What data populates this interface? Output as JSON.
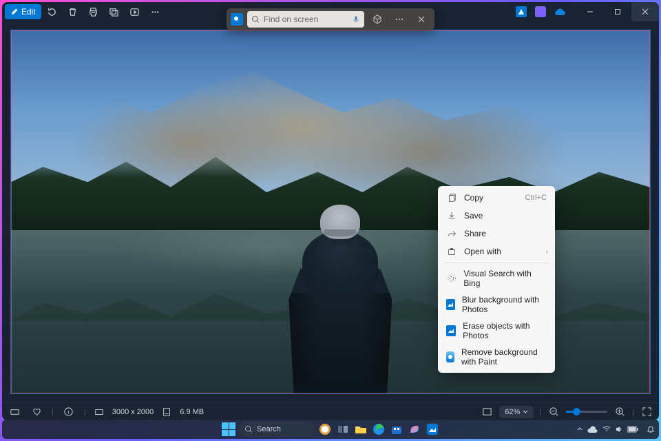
{
  "window": {
    "edit_label": "Edit"
  },
  "search": {
    "placeholder": "Find on screen"
  },
  "context_menu": {
    "copy": "Copy",
    "copy_hint": "Ctrl+C",
    "save": "Save",
    "share": "Share",
    "open_with": "Open with",
    "visual_search": "Visual Search with Bing",
    "blur_bg": "Blur background with Photos",
    "erase_obj": "Erase objects with Photos",
    "remove_bg": "Remove background with Paint"
  },
  "status": {
    "dimensions": "3000 x 2000",
    "filesize": "6.9 MB",
    "zoom": "62%"
  },
  "taskbar": {
    "search_label": "Search",
    "time": "",
    "date": ""
  }
}
